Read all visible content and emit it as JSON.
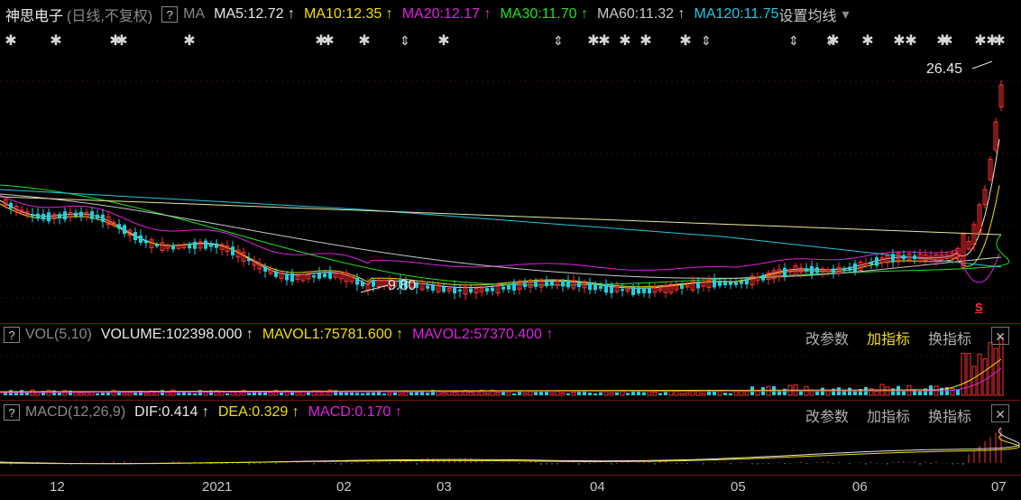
{
  "stock": {
    "name": "神思电子",
    "mode": "(日线,不复权)",
    "help": "?"
  },
  "ma": {
    "label": "MA",
    "items": [
      {
        "text": "MA5:12.72",
        "arrow": "↑",
        "color": "#e8e8e8"
      },
      {
        "text": "MA10:12.35",
        "arrow": "↑",
        "color": "#f0e000"
      },
      {
        "text": "MA20:12.17",
        "arrow": "↑",
        "color": "#e020e0"
      },
      {
        "text": "MA30:11.70",
        "arrow": "↑",
        "color": "#20e020"
      },
      {
        "text": "MA60:11.32",
        "arrow": "↑",
        "color": "#c8c8c8"
      },
      {
        "text": "MA120:11.75",
        "arrow": "",
        "color": "#20c8e0"
      }
    ],
    "settings": "设置均线",
    "dropdown": "▾"
  },
  "price_annotations": {
    "high": "26.45",
    "low": "9.80",
    "marker": "S"
  },
  "vol": {
    "help": "?",
    "label": "VOL(5,10)",
    "volume": "VOLUME:102398.000",
    "mavol1": "MAVOL1:75781.600",
    "mavol2": "MAVOL2:57370.400",
    "arrow": "↑"
  },
  "macd": {
    "help": "?",
    "label": "MACD(12,26,9)",
    "dif": "DIF:0.414",
    "dea": "DEA:0.329",
    "macd": "MACD:0.170",
    "arrow": "↑"
  },
  "panel_buttons": {
    "params": "改参数",
    "add_indicator": "加指标",
    "switch_indicator": "换指标",
    "close": "✕"
  },
  "xaxis": {
    "labels": [
      "12",
      "2021",
      "02",
      "03",
      "04",
      "05",
      "06",
      "07"
    ]
  },
  "colors": {
    "up": "#ff3030",
    "down": "#20d0e0",
    "divider": "#7a1010"
  }
}
